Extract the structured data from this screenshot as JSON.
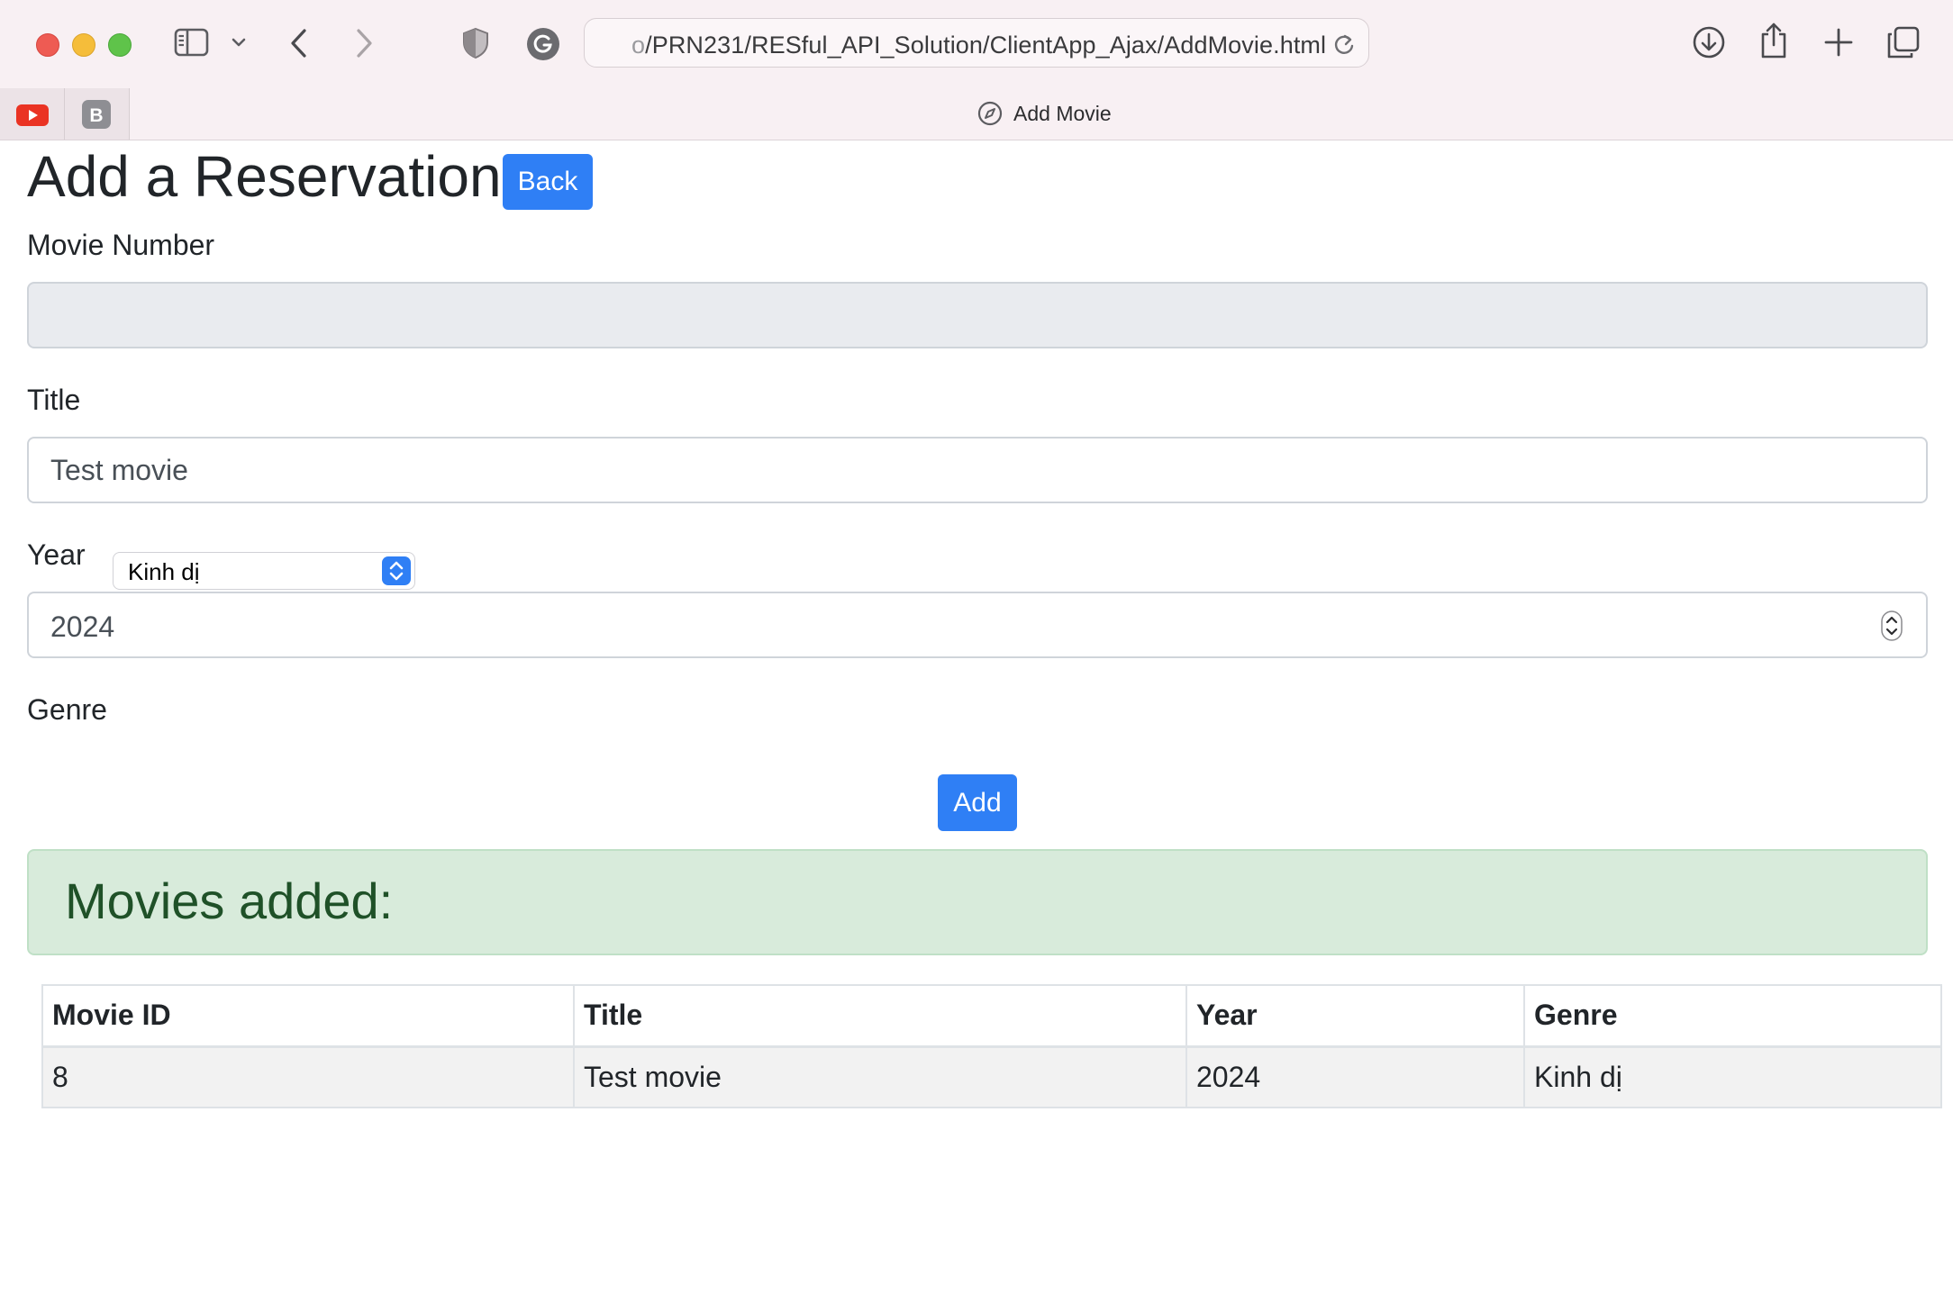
{
  "browser": {
    "url_prefix": "o",
    "url": "/PRN231/RESful_API_Solution/ClientApp_Ajax/AddMovie.html",
    "tab_title": "Add Movie",
    "pinned_tabs": [
      {
        "icon": "youtube-icon"
      },
      {
        "icon": "bootstrap-icon",
        "letter": "B"
      }
    ]
  },
  "page": {
    "heading": "Add a Reservation",
    "back_label": "Back",
    "form": {
      "movie_number_label": "Movie Number",
      "movie_number_value": "",
      "title_label": "Title",
      "title_value": "Test movie",
      "year_label": "Year",
      "year_value": "2024",
      "genre_label": "Genre",
      "genre_selected": "Kinh dị"
    },
    "add_label": "Add",
    "alert_heading": "Movies added:",
    "table": {
      "headers": [
        "Movie ID",
        "Title",
        "Year",
        "Genre"
      ],
      "rows": [
        [
          "8",
          "Test movie",
          "2024",
          "Kinh dị"
        ]
      ]
    }
  },
  "colors": {
    "primary": "#2f7ff5",
    "alert_bg": "#d8ebdb",
    "alert_text": "#1f5128"
  }
}
